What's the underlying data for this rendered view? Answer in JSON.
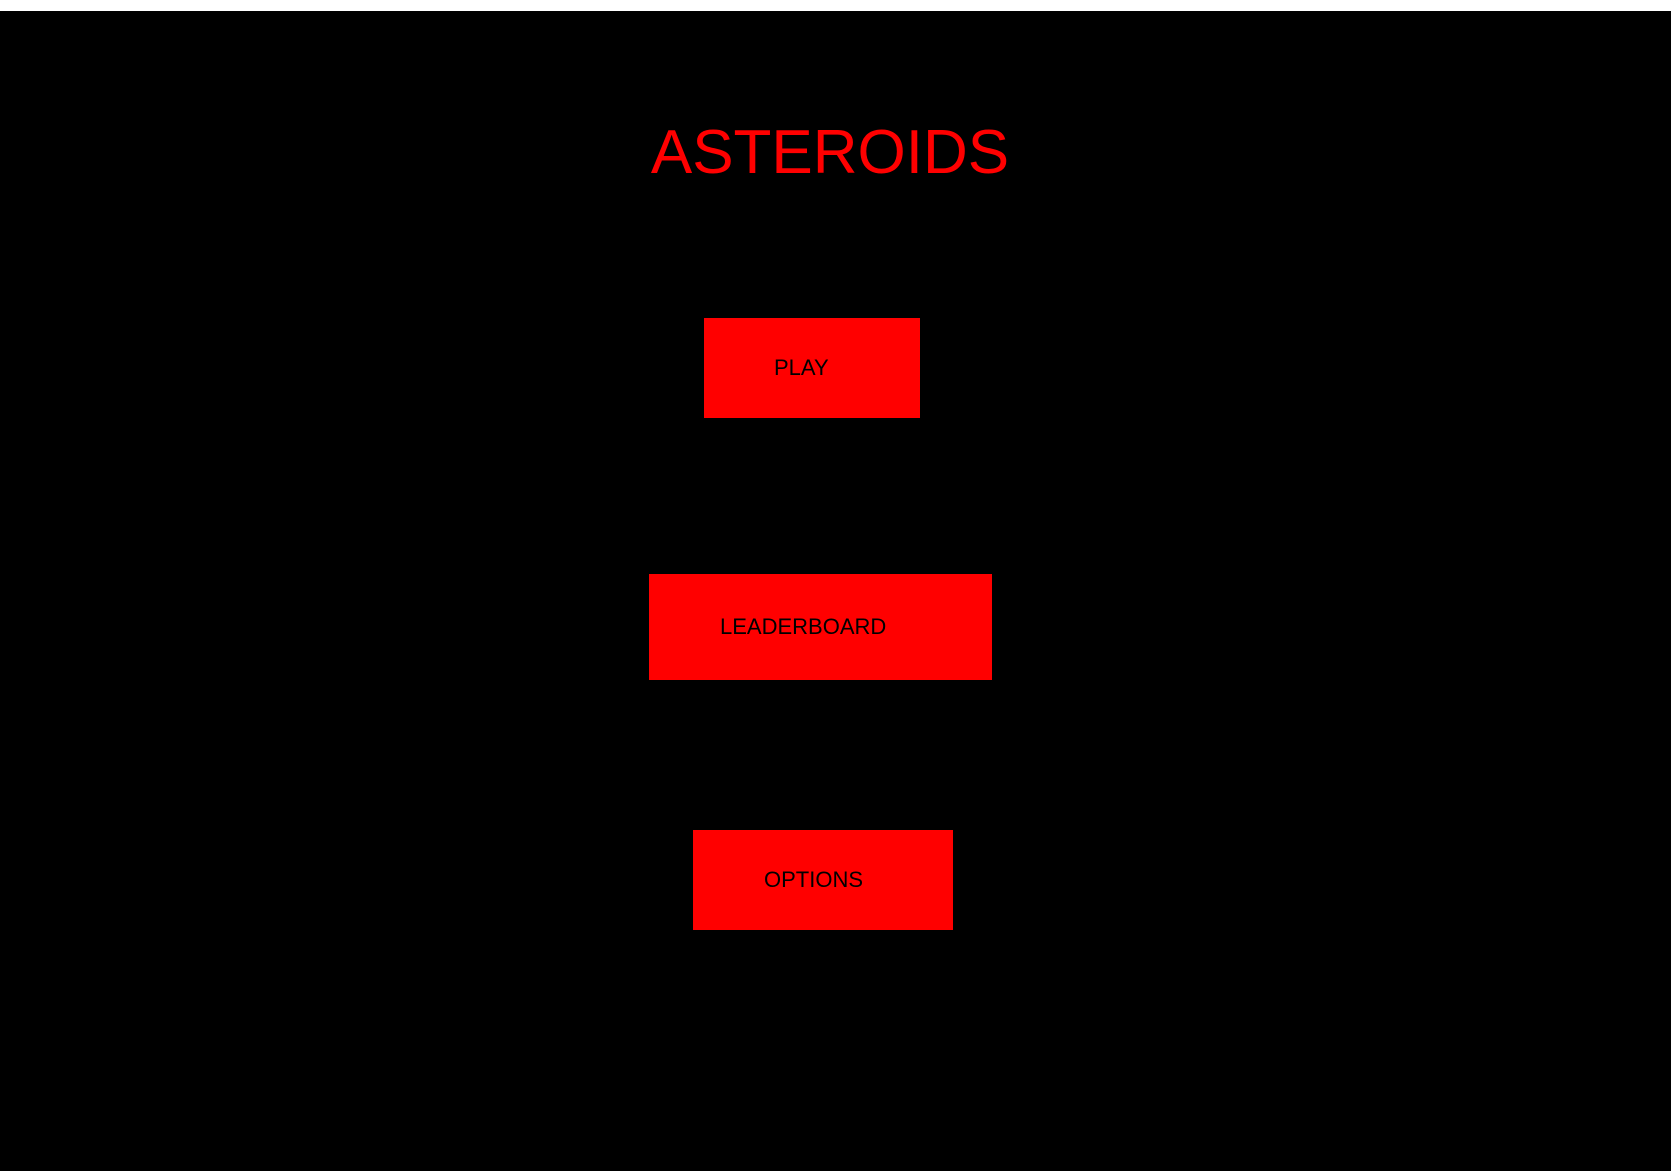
{
  "game": {
    "title": "ASTEROIDS",
    "colors": {
      "background": "#000000",
      "accent": "#ff0000",
      "button_text": "#000000"
    }
  },
  "menu": {
    "play_label": "PLAY",
    "leaderboard_label": "LEADERBOARD",
    "options_label": "OPTIONS"
  }
}
